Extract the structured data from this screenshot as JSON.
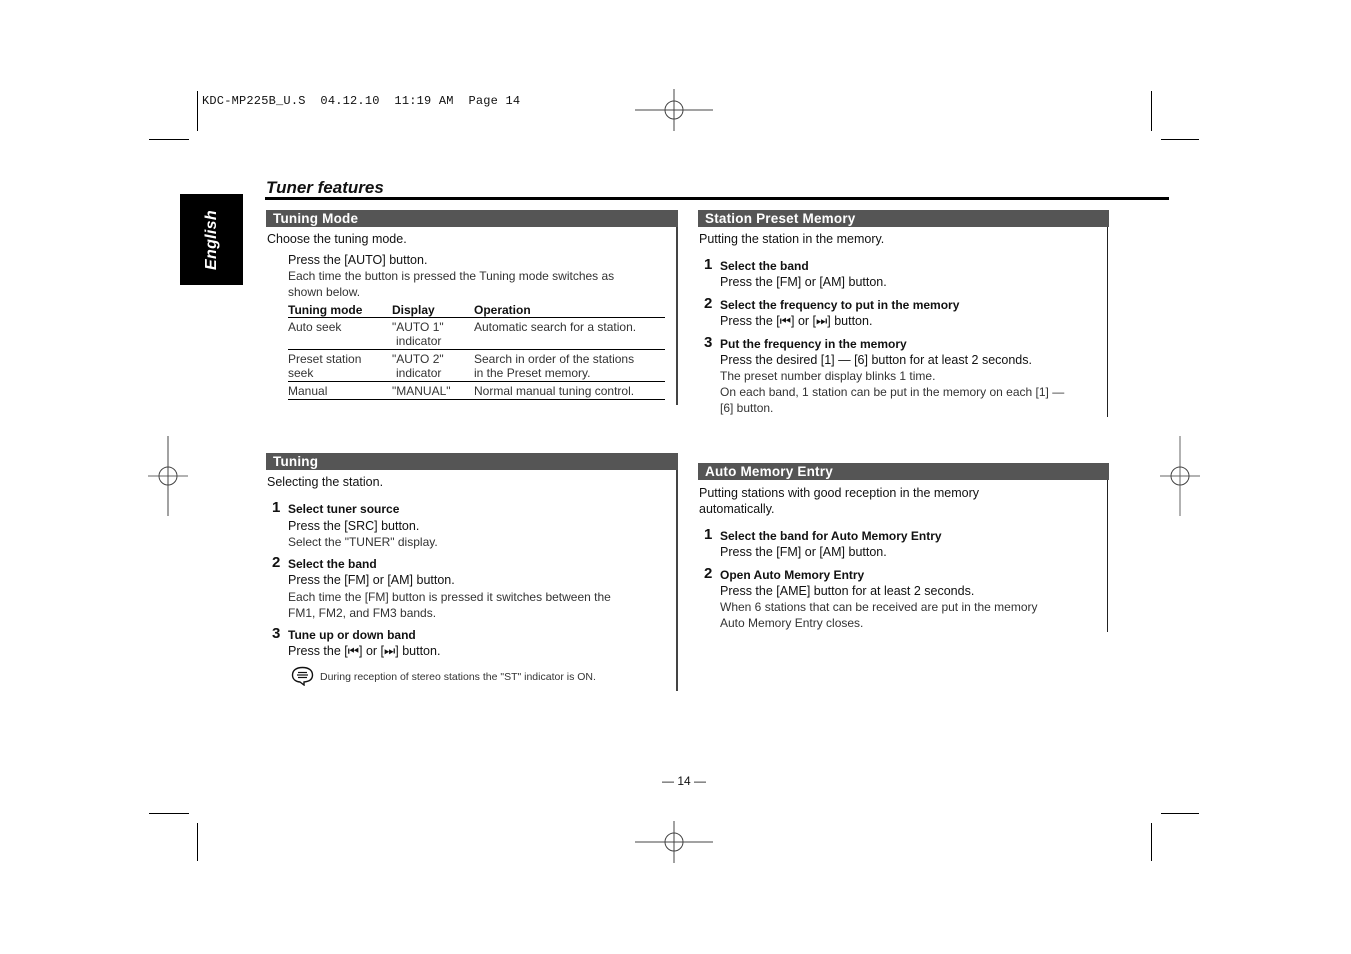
{
  "slug": {
    "text": "KDC-MP225B_U.S  04.12.10  11:19 AM  Page 14"
  },
  "language_tab": {
    "label": "English"
  },
  "page_title": "Tuner features",
  "sections": {
    "tuning_mode": {
      "title": "Tuning Mode",
      "intro": "Choose the tuning mode.",
      "action": "Press the [AUTO] button.",
      "description_lines": [
        "Each time the button is pressed the Tuning mode switches as",
        "shown below."
      ],
      "table": {
        "headers": [
          "Tuning mode",
          "Display",
          "Operation"
        ],
        "rows": [
          {
            "mode": [
              "Auto seek"
            ],
            "display": [
              "\"AUTO 1\"",
              "indicator"
            ],
            "operation": [
              "Automatic search for a station."
            ]
          },
          {
            "mode": [
              "Preset station",
              "seek"
            ],
            "display": [
              "\"AUTO 2\"",
              "indicator"
            ],
            "operation": [
              "Search in order of the stations",
              "in the Preset memory."
            ]
          },
          {
            "mode": [
              "Manual"
            ],
            "display": [
              "\"MANUAL\""
            ],
            "operation": [
              "Normal manual tuning control."
            ]
          }
        ]
      }
    },
    "tuning": {
      "title": "Tuning",
      "intro": "Selecting the station.",
      "steps": [
        {
          "num": "1",
          "heading": "Select tuner source",
          "action": "Press the [SRC] button.",
          "notes": [
            "Select the \"TUNER\" display."
          ]
        },
        {
          "num": "2",
          "heading": "Select the band",
          "action": "Press the [FM] or [AM] button.",
          "notes": [
            "Each time the [FM] button is pressed it switches between the",
            "FM1, FM2, and FM3 bands."
          ]
        },
        {
          "num": "3",
          "heading": "Tune up or down band",
          "action": "Press the [⏮] or [⏭] button.",
          "notes": []
        }
      ],
      "note": "During reception of stereo stations the \"ST\" indicator is ON."
    },
    "station_preset": {
      "title": "Station Preset Memory",
      "intro": "Putting the station in the memory.",
      "steps": [
        {
          "num": "1",
          "heading": "Select the band",
          "action": "Press the [FM] or [AM] button.",
          "notes": []
        },
        {
          "num": "2",
          "heading": "Select the frequency to put in the memory",
          "action": "Press the [⏮] or [⏭] button.",
          "notes": []
        },
        {
          "num": "3",
          "heading": "Put the frequency in the memory",
          "action": "Press the desired [1] — [6] button for at least 2 seconds.",
          "notes": [
            "The preset number display blinks 1 time.",
            "On each band, 1 station can be put in the memory on each [1] —",
            "[6] button."
          ]
        }
      ]
    },
    "auto_memory": {
      "title": "Auto Memory Entry",
      "intro_lines": [
        "Putting stations with good reception in the memory",
        "automatically."
      ],
      "steps": [
        {
          "num": "1",
          "heading": "Select the band for Auto Memory Entry",
          "action": "Press the [FM] or [AM] button.",
          "notes": []
        },
        {
          "num": "2",
          "heading": "Open Auto Memory Entry",
          "action": "Press the [AME] button for at least 2 seconds.",
          "notes": [
            "When 6 stations that can be received are put in the memory",
            "Auto Memory Entry closes."
          ]
        }
      ]
    }
  },
  "folio": "— 14 —",
  "icons": {
    "registration_mark": "crosshair-circle",
    "note": "speech-bubble-note-icon"
  },
  "colors": {
    "section_header_bg": "#555555",
    "language_tab_bg": "#000000"
  }
}
